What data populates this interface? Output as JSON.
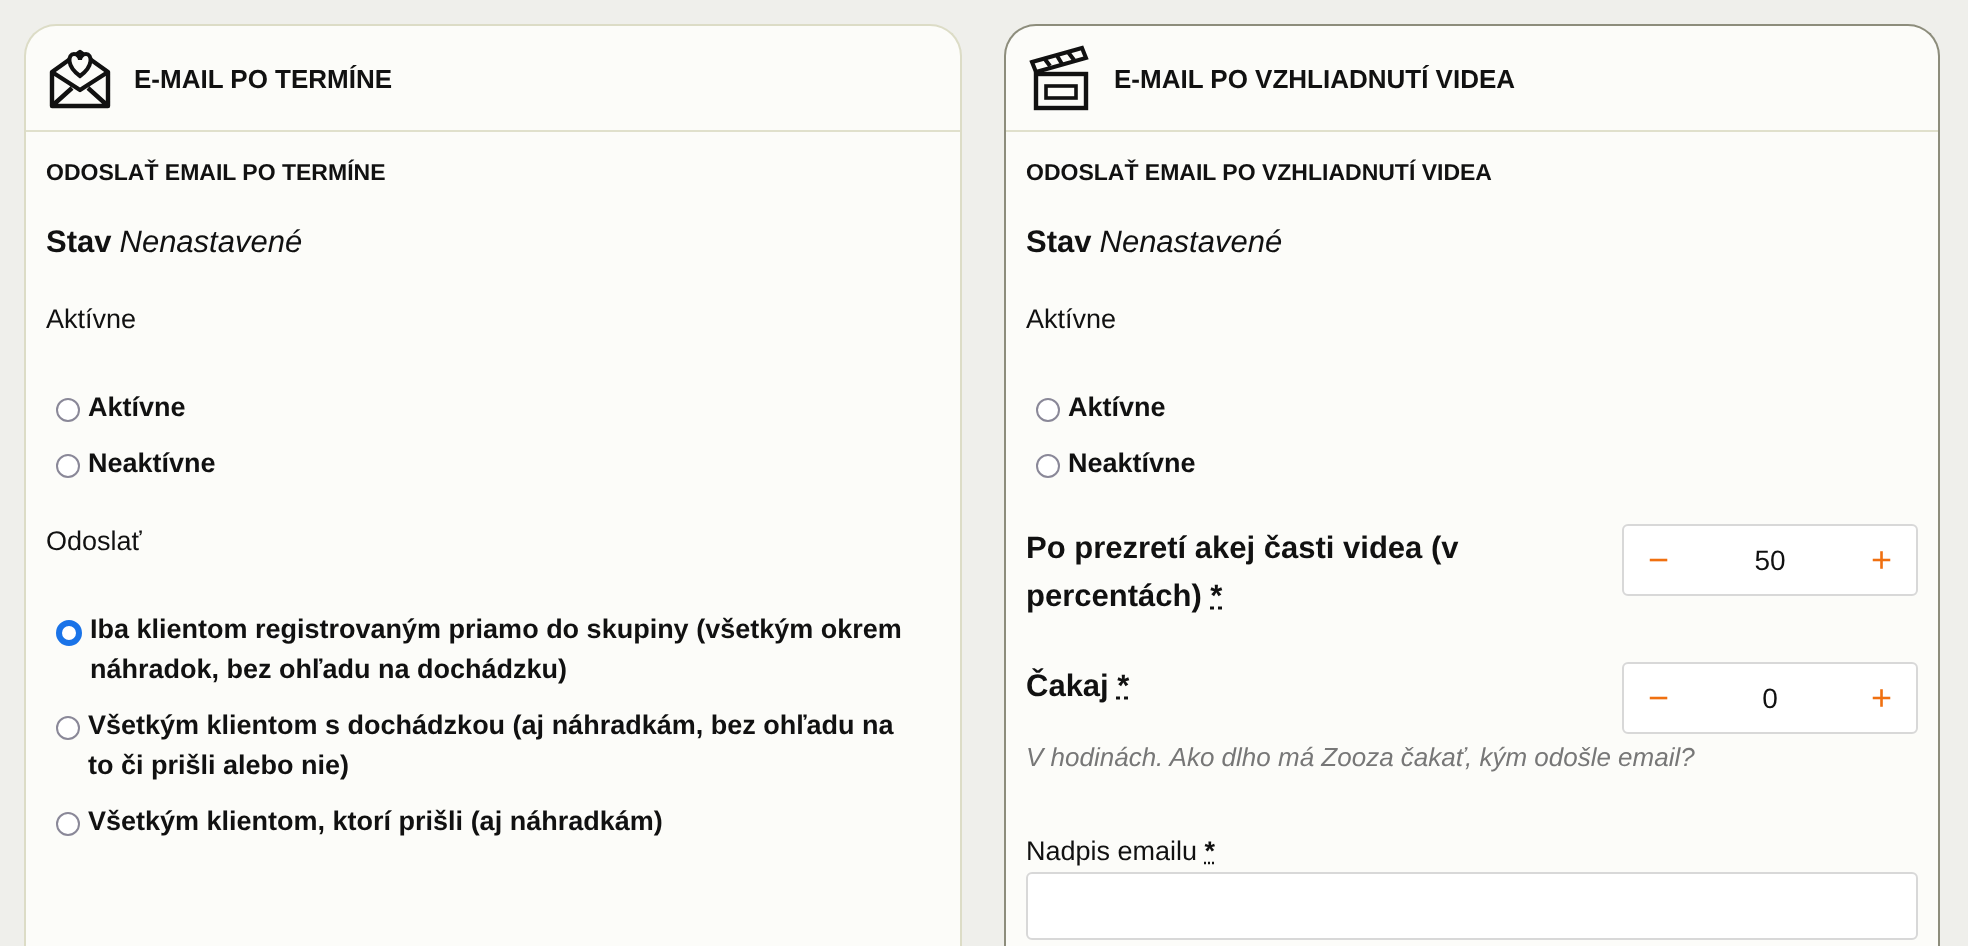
{
  "cards": [
    {
      "title": "E-MAIL PO TERMÍNE",
      "heading": "ODOSLAŤ EMAIL PO TERMÍNE",
      "status_label": "Stav",
      "status_value": "Nenastavené",
      "fields": [
        {
          "kind": "radio_group",
          "label": "Aktívne",
          "options": [
            {
              "label": "Aktívne",
              "selected": false
            },
            {
              "label": "Neaktívne",
              "selected": false
            }
          ]
        },
        {
          "kind": "radio_group",
          "label": "Odoslať",
          "options": [
            {
              "label": "Iba klientom registrovaným priamo do skupiny (všetkým okrem náhradok, bez ohľadu na dochádzku)",
              "selected": true
            },
            {
              "label": "Všetkým klientom s dochádzkou (aj náhradkám, bez ohľadu na to či prišli alebo nie)",
              "selected": false
            },
            {
              "label": "Všetkým klientom, ktorí prišli (aj náhradkám)",
              "selected": false
            }
          ]
        }
      ]
    },
    {
      "title": "E-MAIL PO VZHLIADNUTÍ VIDEA",
      "heading": "ODOSLAŤ EMAIL PO VZHLIADNUTÍ VIDEA",
      "status_label": "Stav",
      "status_value": "Nenastavené",
      "fields": [
        {
          "kind": "radio_group",
          "label": "Aktívne",
          "options": [
            {
              "label": "Aktívne",
              "selected": false
            },
            {
              "label": "Neaktívne",
              "selected": false
            }
          ]
        },
        {
          "kind": "stepper",
          "label": "Po prezretí akej časti videa (v percentách)",
          "required_mark": "*",
          "decrement": "−",
          "value": "50",
          "increment": "+"
        },
        {
          "kind": "stepper",
          "label": "Čakaj",
          "required_mark": "*",
          "decrement": "−",
          "value": "0",
          "increment": "+",
          "hint": "V hodinách. Ako dlho má Zooza čakať, kým odošle email?"
        },
        {
          "kind": "text_input",
          "label": "Nadpis emailu",
          "required_mark": "*"
        }
      ]
    }
  ]
}
